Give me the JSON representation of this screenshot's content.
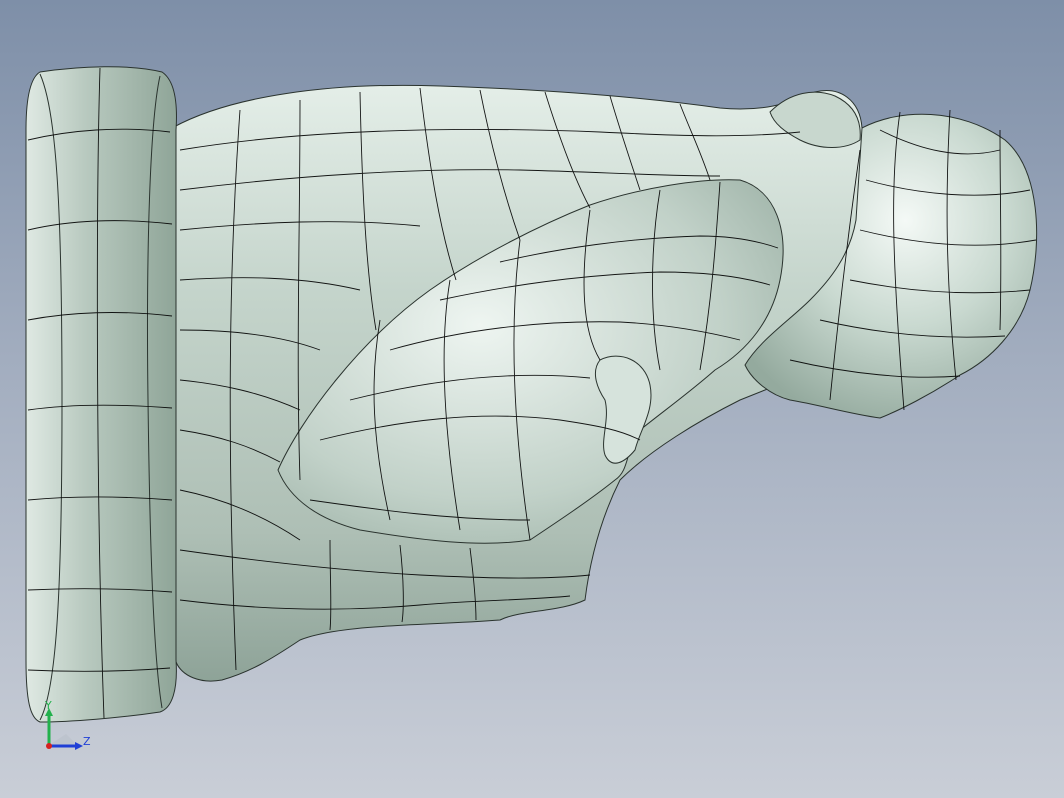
{
  "viewport": {
    "background_top": "#7e8fa8",
    "background_bottom": "#c9ced7"
  },
  "model": {
    "surface_color": "#c6d6cd",
    "highlight_color": "#eef5f1",
    "shadow_color": "#7f968a",
    "mesh_line_color": "#000000",
    "render_mode": "shaded-with-patch-edges"
  },
  "triad": {
    "y_label": "Y",
    "z_label": "Z",
    "y_color": "#22b14c",
    "z_color": "#1f3fd6",
    "x_color": "#d62020"
  }
}
